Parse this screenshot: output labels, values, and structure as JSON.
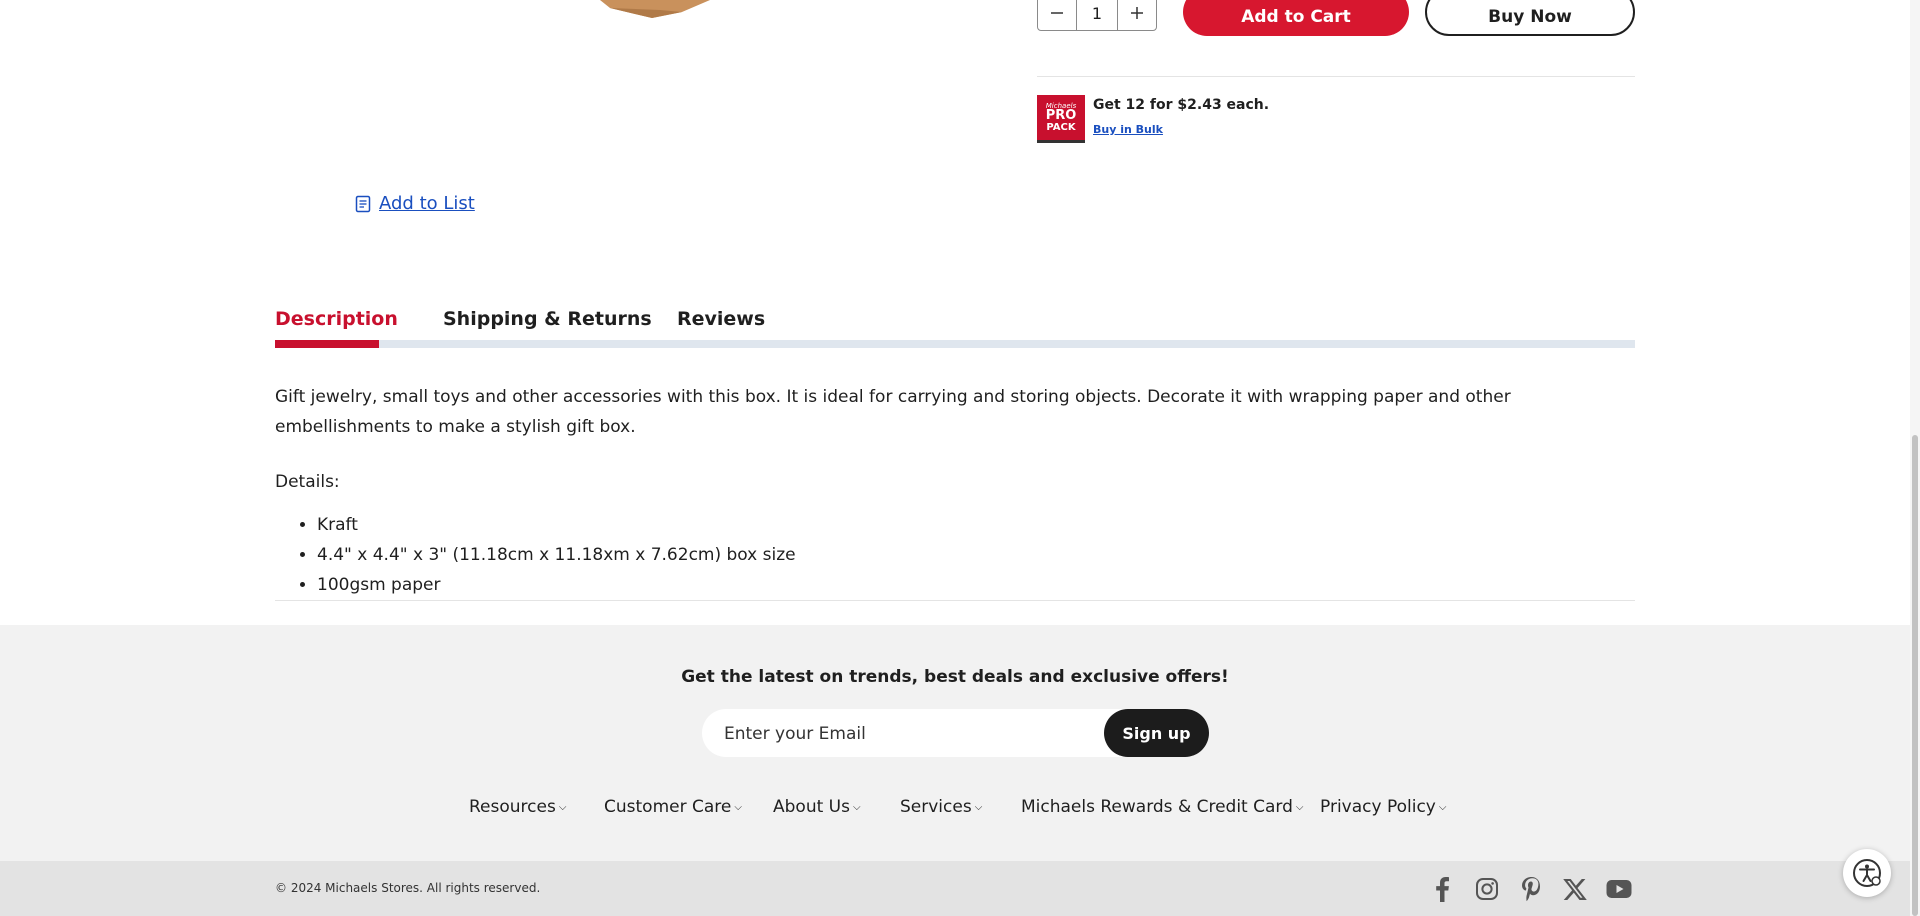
{
  "product": {
    "quantity": "1",
    "add_to_cart": "Add to Cart",
    "buy_now": "Buy Now",
    "pro_pack": {
      "logo_line1": "Michaels",
      "logo_line2": "PRO",
      "logo_line3": "PACK",
      "offer": "Get 12 for $2.43 each.",
      "link": "Buy in Bulk"
    },
    "add_to_list": "Add to List"
  },
  "tabs": [
    {
      "label": "Description"
    },
    {
      "label": "Shipping & Returns"
    },
    {
      "label": "Reviews"
    }
  ],
  "description": {
    "text": "Gift jewelry, small toys and other accessories with this box. It is ideal for carrying and storing objects. Decorate it with wrapping paper and other embellishments to make a stylish gift box.",
    "details_label": "Details:",
    "details": [
      "Kraft",
      "4.4\" x 4.4\" x 3\" (11.18cm x 11.18xm x 7.62cm) box size",
      "100gsm paper"
    ]
  },
  "newsletter": {
    "title": "Get the latest on trends, best deals and exclusive offers!",
    "placeholder": "Enter your Email",
    "button": "Sign up"
  },
  "footer_nav": [
    "Resources",
    "Customer Care",
    "About Us",
    "Services",
    "Michaels Rewards & Credit Card",
    "Privacy Policy"
  ],
  "copyright": "© 2024 Michaels Stores. All rights reserved.",
  "social": [
    "facebook-icon",
    "instagram-icon",
    "pinterest-icon",
    "x-icon",
    "youtube-icon"
  ],
  "colors": {
    "brand_red": "#d7172f",
    "link_blue": "#1a4fbf"
  }
}
